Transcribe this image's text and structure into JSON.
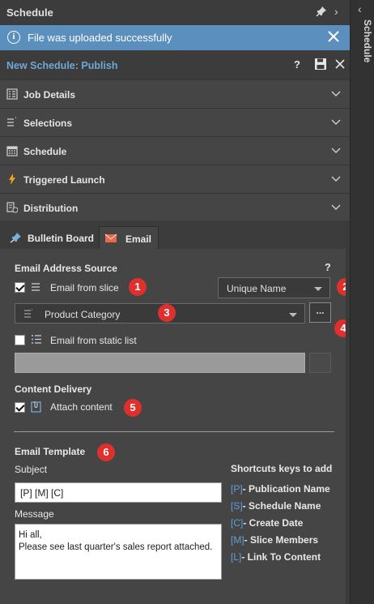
{
  "panel": {
    "title": "Schedule",
    "side_tab_label": "Schedule"
  },
  "notification": {
    "message": "File was uploaded successfully"
  },
  "header": {
    "title": "New Schedule: Publish",
    "help": "?"
  },
  "sections": [
    {
      "label": "Job Details",
      "icon": "job-details-icon"
    },
    {
      "label": "Selections",
      "icon": "selections-icon"
    },
    {
      "label": "Schedule",
      "icon": "calendar-icon"
    },
    {
      "label": "Triggered Launch",
      "icon": "lightning-icon"
    },
    {
      "label": "Distribution",
      "icon": "distribution-icon"
    }
  ],
  "tabs": [
    {
      "label": "Bulletin Board",
      "icon": "pin-icon",
      "active": false
    },
    {
      "label": "Email",
      "icon": "envelope-icon",
      "active": true
    }
  ],
  "email": {
    "address_source_label": "Email Address Source",
    "help": "?",
    "from_slice": {
      "label": "Email from slice",
      "checked": true
    },
    "name_dropdown": {
      "value": "Unique Name"
    },
    "category_dropdown": {
      "value": "Product Category"
    },
    "ellipsis": "...",
    "static_list": {
      "label": "Email from static list",
      "checked": false
    },
    "content_delivery_label": "Content Delivery",
    "attach_content": {
      "label": "Attach content",
      "checked": true
    },
    "template_label": "Email Template",
    "subject_label": "Subject",
    "subject_value": "[P] [M] [C]",
    "message_label": "Message",
    "message_value": "Hi all,\nPlease see last quarter's sales report attached.",
    "shortcuts_title": "Shortcuts keys to add",
    "shortcuts": [
      {
        "key": "[P]",
        "label": "- Publication Name"
      },
      {
        "key": "[S]",
        "label": "- Schedule Name"
      },
      {
        "key": "[C]",
        "label": "- Create Date"
      },
      {
        "key": "[M]",
        "label": "- Slice Members"
      },
      {
        "key": "[L]",
        "label": "- Link To Content"
      }
    ]
  },
  "callouts": [
    "1",
    "2",
    "3",
    "4",
    "5",
    "6"
  ],
  "colors": {
    "accent": "#5b8fbd",
    "link": "#6fa7d6",
    "callout": "#e0302d",
    "shortcut_key": "#5ea0d8"
  }
}
